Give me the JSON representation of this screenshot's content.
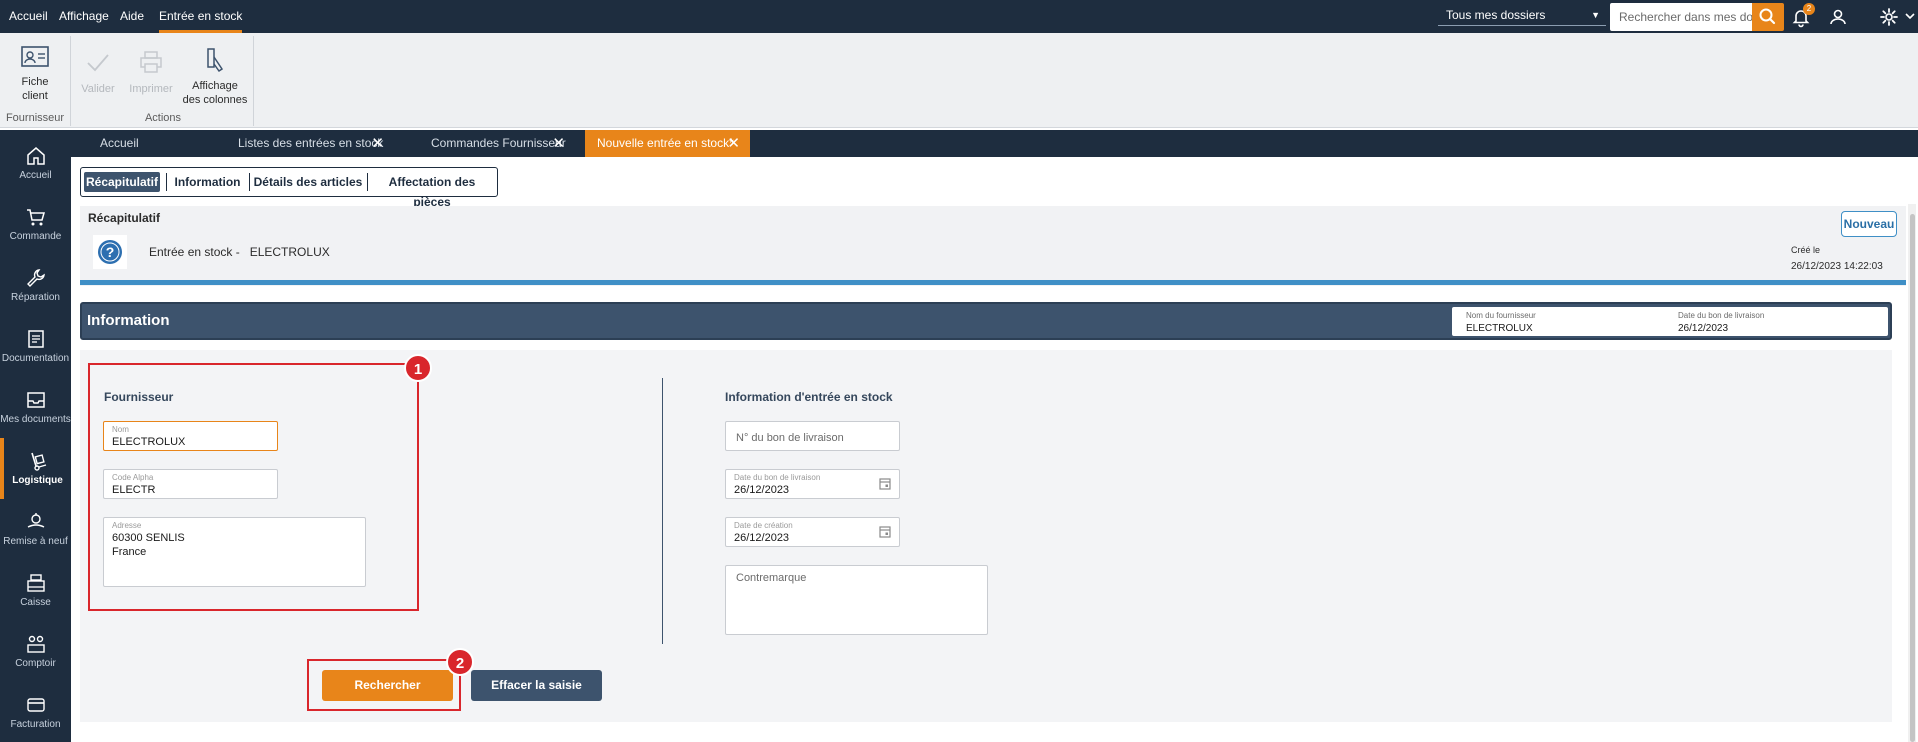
{
  "menu": {
    "items": [
      "Accueil",
      "Affichage",
      "Aide",
      "Entrée en stock"
    ]
  },
  "header": {
    "dossier_select": "Tous mes dossiers",
    "search_placeholder": "Rechercher dans mes dossiers",
    "notification_count": "2"
  },
  "ribbon": {
    "fiche_client": "Fiche\nclient",
    "group_fournisseur": "Fournisseur",
    "valider": "Valider",
    "imprimer": "Imprimer",
    "affichage_colonnes": "Affichage\ndes colonnes",
    "group_actions": "Actions"
  },
  "nav": {
    "items": [
      "Accueil",
      "Commande",
      "Réparation",
      "Documentation",
      "Mes documents",
      "Logistique",
      "Remise à neuf",
      "Caisse",
      "Comptoir",
      "Facturation"
    ]
  },
  "tabs": {
    "items": [
      "Accueil",
      "Listes des entrées en stock",
      "Commandes Fournisseur",
      "Nouvelle entrée en stock*"
    ]
  },
  "subtabs": {
    "items": [
      "Récapitulatif",
      "Information",
      "Détails des articles",
      "Affectation des pièces"
    ]
  },
  "recap": {
    "title": "Récapitulatif",
    "entry_label": "Entrée en stock -   ELECTROLUX",
    "nouveau": "Nouveau",
    "created_label": "Créé le",
    "created_value": "26/12/2023 14:22:03"
  },
  "info_band": {
    "title": "Information",
    "supplier_name_label": "Nom du fournisseur",
    "supplier_name_value": "ELECTROLUX",
    "delivery_date_label": "Date du bon de livraison",
    "delivery_date_value": "26/12/2023"
  },
  "fournisseur": {
    "title": "Fournisseur",
    "nom_label": "Nom",
    "nom_value": "ELECTROLUX",
    "code_label": "Code Alpha",
    "code_value": "ELECTR",
    "adresse_label": "Adresse",
    "adresse_value": "60300 SENLIS\nFrance"
  },
  "entree": {
    "title": "Information d'entrée en stock",
    "bon_placeholder": "N° du bon de livraison",
    "date_bon_label": "Date du bon de livraison",
    "date_bon_value": "26/12/2023",
    "date_creation_label": "Date de création",
    "date_creation_value": "26/12/2023",
    "contremarque_placeholder": "Contremarque"
  },
  "actions": {
    "rechercher": "Rechercher",
    "effacer": "Effacer la saisie"
  },
  "annotations": {
    "badge1": "1",
    "badge2": "2"
  },
  "colors": {
    "accent": "#e8851a",
    "navy": "#1e2d3f",
    "slate": "#3d536d",
    "highlight_red": "#d9262c"
  }
}
